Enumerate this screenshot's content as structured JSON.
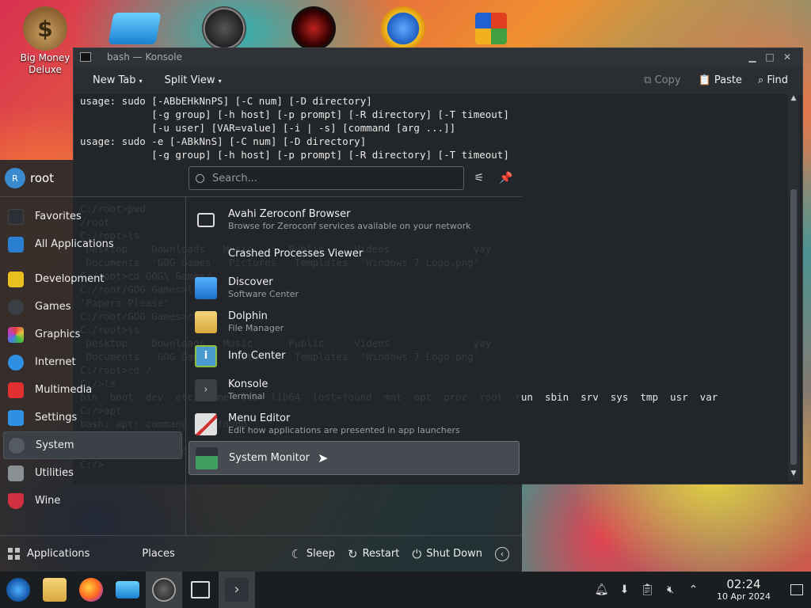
{
  "desktop": {
    "icons": [
      {
        "label": "Big Money\nDeluxe",
        "icon": "money-bag-icon"
      },
      {
        "label": "",
        "icon": "virtual-drive-icon"
      },
      {
        "label": "",
        "icon": "speedometer-icon"
      },
      {
        "label": "",
        "icon": "red-disc-icon"
      },
      {
        "label": "",
        "icon": "globe-star-icon"
      },
      {
        "label": "",
        "icon": "office-grid-icon"
      }
    ]
  },
  "konsole": {
    "title": "bash — Konsole",
    "toolbar": {
      "new_tab": "New Tab",
      "split_view": "Split View",
      "copy": "Copy",
      "paste": "Paste",
      "find": "Find"
    },
    "terminal_text": "usage: sudo [-ABbEHkNnPS] [-C num] [-D directory]\n            [-g group] [-h host] [-p prompt] [-R directory] [-T timeout]\n            [-u user] [VAR=value] [-i | -s] [command [arg ...]]\nusage: sudo -e [-ABkNnS] [-C num] [-D directory]\n            [-g group] [-h host] [-p prompt] [-R directory] [-T timeout]\n\n\n\nC:/root>pwd\n/root\nC:/root>ls\n Desktop    Downloads   Music      Public     Videos              yay\n Documents  'GOG Games'  Pictures   Templates  'Windows 7 Logo.png'\nC:/root>cd GOG\\ Games/\nC:/root/GOG Games>ls\n'Papers Please'\nC:/root/GOG Games>cd\nC:/root>ls\n Desktop    Downloads   Music      Public     Videos              yay\n Documents  'GOG Games'  Pictures   Templates  'Windows 7 Logo.png'\nC:/root>cd /\nC:/>ls\nbin  boot  dev  etc  home  lib  lib64  lost+found  mnt  opt  proc  root  run  sbin  srv  sys  tmp  usr  var\nC:/>apt\nbash: apt: command not found\nC:/>pkg\nbash: pkg: command not found\nC:/>"
  },
  "launcher": {
    "user": {
      "name": "root",
      "initial": "R"
    },
    "search": {
      "placeholder": "Search..."
    },
    "categories": [
      {
        "label": "Favorites",
        "icon": "bookmark-icon",
        "color": "#2c3036"
      },
      {
        "label": "All Applications",
        "icon": "grid-icon",
        "color": "#2b7fd0"
      },
      {
        "label": "Development",
        "icon": "development-icon",
        "color": "#e8c020"
      },
      {
        "label": "Games",
        "icon": "gamepad-icon",
        "color": "#3a3f44"
      },
      {
        "label": "Graphics",
        "icon": "graphics-icon",
        "color": "#c040c0"
      },
      {
        "label": "Internet",
        "icon": "cloud-icon",
        "color": "#2f8fe0"
      },
      {
        "label": "Multimedia",
        "icon": "play-icon",
        "color": "#e03030"
      },
      {
        "label": "Settings",
        "icon": "settings-icon",
        "color": "#2f8fe0"
      },
      {
        "label": "System",
        "icon": "gear-icon",
        "color": "#555b62"
      },
      {
        "label": "Utilities",
        "icon": "utilities-icon",
        "color": "#8a8f94"
      },
      {
        "label": "Wine",
        "icon": "wine-icon",
        "color": "#d03040"
      }
    ],
    "apps": [
      {
        "name": "Avahi Zeroconf Browser",
        "desc": "Browse for Zeroconf services available on your network",
        "icon": "monitor-icon",
        "color": "#2a2e32"
      },
      {
        "name": "Crashed Processes Viewer",
        "desc": "",
        "icon": "crash-icon",
        "color": "transparent"
      },
      {
        "name": "Discover",
        "desc": "Software Center",
        "icon": "discover-bag-icon",
        "color": "#2f8fe0"
      },
      {
        "name": "Dolphin",
        "desc": "File Manager",
        "icon": "folder-icon",
        "color": "#e8c050"
      },
      {
        "name": "Info Center",
        "desc": "",
        "icon": "info-icon",
        "color": "#4a9ad0"
      },
      {
        "name": "Konsole",
        "desc": "Terminal",
        "icon": "terminal-icon",
        "color": "#3a3f44"
      },
      {
        "name": "Menu Editor",
        "desc": "Edit how applications are presented in app launchers",
        "icon": "menu-editor-icon",
        "color": "#d0d0d0"
      },
      {
        "name": "System Monitor",
        "desc": "",
        "icon": "system-monitor-icon",
        "color": "#40a060"
      }
    ],
    "footer": {
      "applications": "Applications",
      "places": "Places",
      "sleep": "Sleep",
      "restart": "Restart",
      "shutdown": "Shut Down"
    }
  },
  "taskbar": {
    "clock_time": "02:24",
    "clock_date": "10 Apr 2024"
  }
}
